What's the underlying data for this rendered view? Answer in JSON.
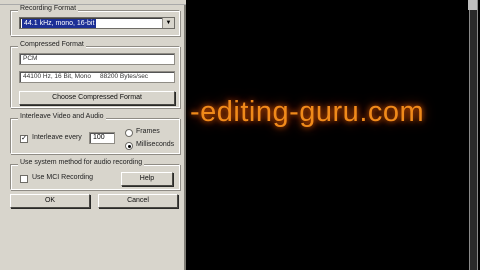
{
  "recording_format": {
    "label": "Recording Format",
    "selected": "44.1 kHz, mono, 16-bit"
  },
  "compressed_format": {
    "label": "Compressed Format",
    "codec": "PCM",
    "details": "44100 Hz, 16 Bit, Mono",
    "bytes_per_sec": "88200 Bytes/sec",
    "choose_button": "Choose Compressed Format"
  },
  "interleave": {
    "label": "Interleave Video and Audio",
    "checkbox_label": "Interleave every",
    "checked": true,
    "value": "100",
    "option_frames": "Frames",
    "option_ms": "Milliseconds",
    "selected_option": "Milliseconds"
  },
  "system_method": {
    "label": "Use system method for audio recording",
    "mci_label": "Use MCI Recording",
    "mci_checked": false,
    "help_button": "Help"
  },
  "buttons": {
    "ok": "OK",
    "cancel": "Cancel"
  },
  "watermark": {
    "text": "-editing-guru.com",
    "color": "#f08a1a"
  }
}
